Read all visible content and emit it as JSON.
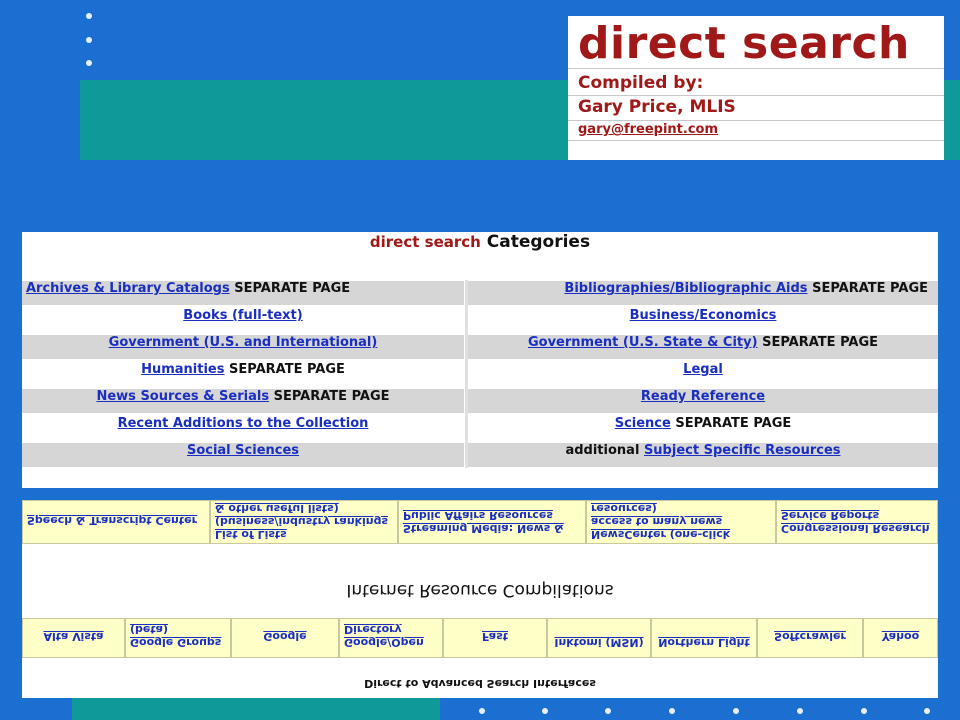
{
  "logo": {
    "title": "direct search",
    "compiled_by": "Compiled by:",
    "author": "Gary Price, MLIS",
    "email": "gary@freepint.com"
  },
  "categories": {
    "title_red": "direct search",
    "title_rest": "Categories",
    "separate_page": "SEPARATE PAGE",
    "additional": "additional",
    "rows": [
      {
        "left": {
          "link": "Archives & Library Catalogs",
          "suffix": "SEPARATE PAGE"
        },
        "right": {
          "link": "Bibliographies/Bibliographic Aids",
          "suffix": "SEPARATE PAGE"
        }
      },
      {
        "left": {
          "link": "Books (full-text)",
          "suffix": ""
        },
        "right": {
          "link": "Business/Economics",
          "suffix": ""
        }
      },
      {
        "left": {
          "link": "Government (U.S. and International)",
          "suffix": ""
        },
        "right": {
          "link": "Government (U.S. State & City)",
          "suffix": "SEPARATE PAGE"
        }
      },
      {
        "left": {
          "link": "Humanities",
          "suffix": "SEPARATE PAGE"
        },
        "right": {
          "link": "Legal",
          "suffix": ""
        }
      },
      {
        "left": {
          "link": "News Sources & Serials",
          "suffix": "SEPARATE PAGE"
        },
        "right": {
          "link": "Ready Reference",
          "suffix": ""
        }
      },
      {
        "left": {
          "link": "Recent Additions to the Collection",
          "suffix": ""
        },
        "right": {
          "link": "Science",
          "suffix": "SEPARATE PAGE"
        }
      },
      {
        "left": {
          "link": "Social Sciences",
          "suffix": ""
        },
        "right": {
          "prefix": "additional",
          "link": "Subject Specific Resources",
          "suffix": ""
        }
      }
    ]
  },
  "mirrored_panel": {
    "compilations_title": "Internet Resource Compilations",
    "advanced_title": "Direct to Advanced Search Interfaces",
    "compilations": [
      "Speech & Transcript Center",
      "List of Lists (business/industry rankings & other useful lists)",
      "Streaming Media: News & Public Affairs Resources",
      "NewsCenter (one-click access to many news resources)",
      "Congressional Research Service Reports"
    ],
    "engines": [
      "Alta Vista",
      "Google Groups (beta)",
      "Google",
      "Google/Open Directory",
      "Fast",
      "Inktomi (MSN)",
      "Northern Light",
      "Softcrawler",
      "Yahoo"
    ]
  }
}
